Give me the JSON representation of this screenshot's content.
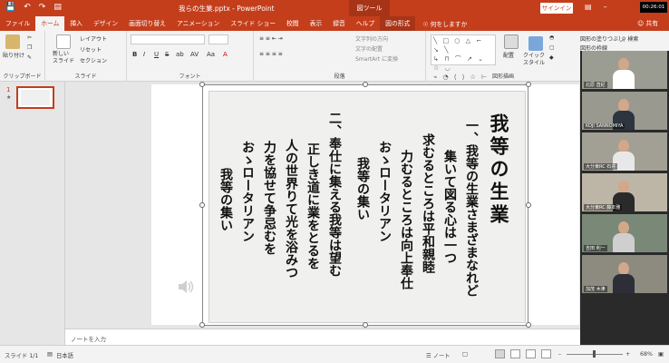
{
  "titlebar": {
    "doc_title": "我らの生業.pptx - PowerPoint",
    "context_tab": "図ツール",
    "signin": "サインイン",
    "timer": "00:26:01",
    "qa_icons": [
      "save-icon",
      "undo-icon",
      "redo-icon",
      "slideshow-icon"
    ]
  },
  "tabs": {
    "items": [
      "ファイル",
      "ホーム",
      "挿入",
      "デザイン",
      "画面切り替え",
      "アニメーション",
      "スライド ショー",
      "校閲",
      "表示",
      "録音",
      "ヘルプ",
      "図の形式"
    ],
    "active": "ホーム",
    "tellme": "何をしますか",
    "share": "共有"
  },
  "ribbon": {
    "clipboard": {
      "paste": "貼り付け",
      "label": "クリップボード"
    },
    "slides": {
      "new_slide": "新しい\nスライド",
      "layout": "レイアウト",
      "reset": "リセット",
      "section": "セクション",
      "label": "スライド"
    },
    "font": {
      "label": "フォント",
      "fmt": [
        "B",
        "I",
        "U",
        "S",
        "ab",
        "AV",
        "Aa",
        "A"
      ]
    },
    "paragraph": {
      "label": "段落",
      "text_dir": "文字列の方向",
      "align_text": "文字の配置",
      "smartart": "SmartArt に変換"
    },
    "drawing": {
      "label": "図形描画",
      "arrange": "配置",
      "quick_style": "クイック\nスタイル",
      "fill": "図形の塗りつぶし",
      "outline": "図形の枠線",
      "effect": "図形の効果"
    },
    "editing": {
      "search": "検索"
    }
  },
  "thumbnails": {
    "number": "1",
    "star": "★"
  },
  "slide": {
    "columns": [
      {
        "text": "我等の生業",
        "big": true
      },
      {
        "text": "一、我等の生業さまざまなれど"
      },
      {
        "text": "集いて図る心は一つ"
      },
      {
        "text": "求むるところは平和親睦"
      },
      {
        "text": "力むるところは向上奉仕"
      },
      {
        "text": "おゝロータリアン"
      },
      {
        "text": "我等の集い"
      },
      {
        "text": "二、奉仕に集える我等は望む"
      },
      {
        "text": "正しき道に業をとるを"
      },
      {
        "text": "人の世界りて光を浴みつ"
      },
      {
        "text": "力を協せて争忌むを"
      },
      {
        "text": "おゝロータリアン"
      },
      {
        "text": "我等の集い"
      }
    ],
    "audio_icon": "speaker-icon"
  },
  "notes": {
    "placeholder": "ノートを入力"
  },
  "participants": [
    {
      "name": "北原 直紀",
      "bg": "#9b9d93",
      "shirt": "#ffffff"
    },
    {
      "name": "KOJI SANNOMIYA",
      "bg": "#9a9990",
      "shirt": "#2c3540"
    },
    {
      "name": "大分東RC 石井",
      "bg": "#a29f95",
      "shirt": "#e8e8e8"
    },
    {
      "name": "大分東RC 藤本雅",
      "bg": "#bdb6a7",
      "shirt": "#2a2a2a"
    },
    {
      "name": "吉田 利一",
      "bg": "#7a8878",
      "shirt": "#cfcfcf"
    },
    {
      "name": "加茂 木津",
      "bg": "#8d8a80",
      "shirt": "#2e2e38"
    }
  ],
  "status": {
    "slide": "スライド 1/1",
    "lang": "日本語",
    "notes": "ノート",
    "zoom": "68%",
    "zoom_level": 0.68
  },
  "colors": {
    "accent": "#c43e1c"
  }
}
